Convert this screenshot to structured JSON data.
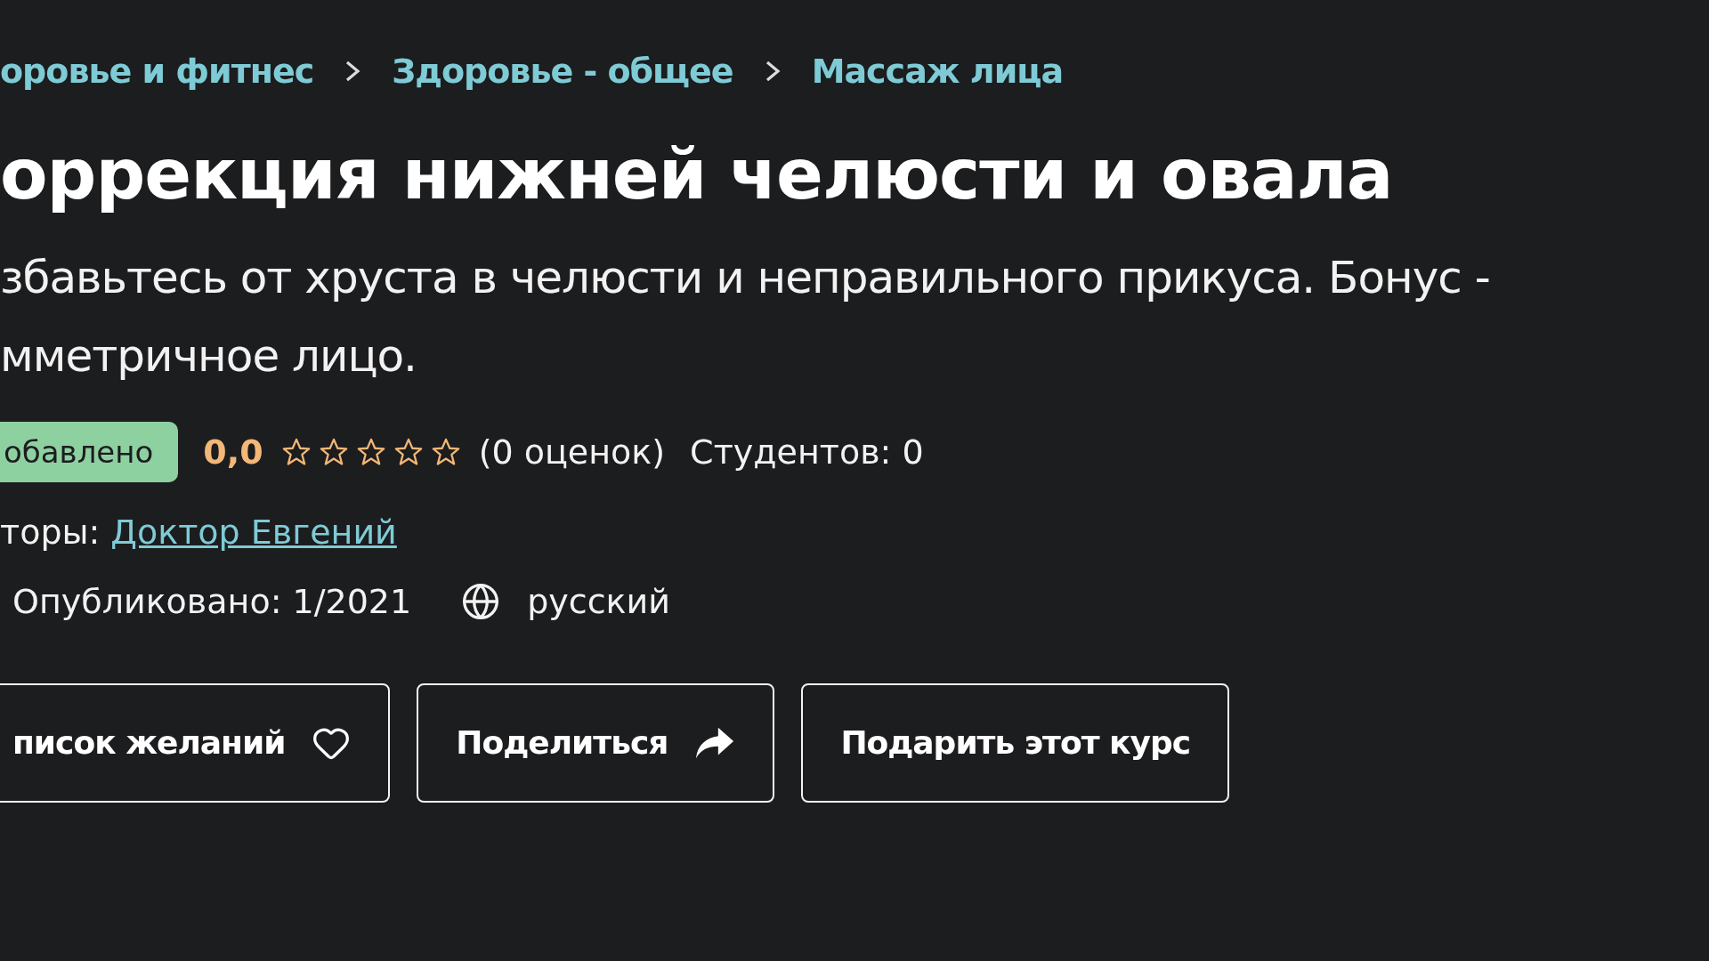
{
  "breadcrumbs": [
    {
      "label": "оровье и фитнес"
    },
    {
      "label": "Здоровье - общее"
    },
    {
      "label": "Массаж лица"
    }
  ],
  "title": "оррекция нижней челюсти и овала",
  "description": [
    "збавьтесь от хруста в челюсти и неправильного прикуса. Бонус -",
    "мметричное лицо."
  ],
  "badge": "обавлено",
  "rating": {
    "value": "0,0",
    "stars": 0,
    "count": "(0 оценок)"
  },
  "students": "Студентов: 0",
  "authors": {
    "label": "торы:",
    "name": "Доктор Евгений"
  },
  "published": "Опубликовано: 1/2021",
  "language": "русский",
  "buttons": [
    {
      "kind": "wishlist",
      "label": "писок желаний"
    },
    {
      "kind": "share",
      "label": "Поделиться"
    },
    {
      "kind": "gift",
      "label": "Подарить этот курс"
    }
  ]
}
